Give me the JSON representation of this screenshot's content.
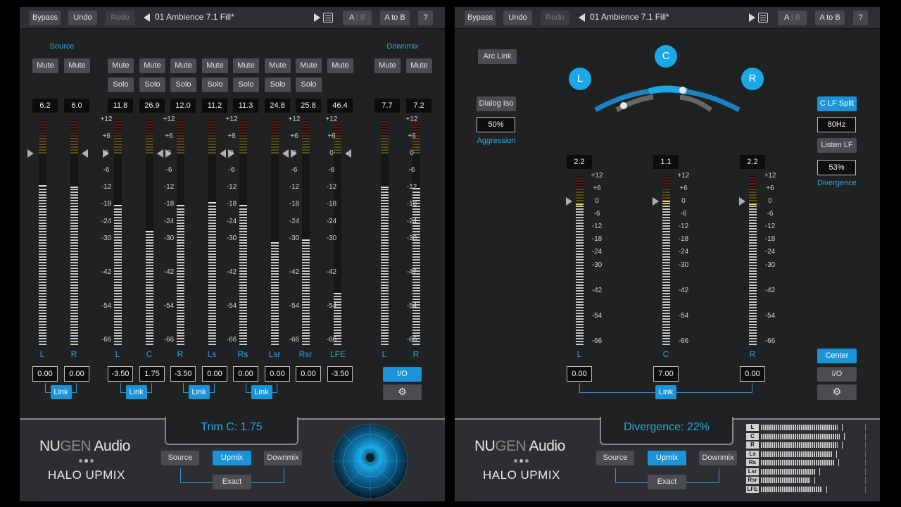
{
  "left": {
    "topbar": {
      "bypass": "Bypass",
      "undo": "Undo",
      "redo": "Redo",
      "preset": "01 Ambience 7.1 Fill*",
      "ab_a": "A",
      "ab_sep": "|",
      "ab_b": "B",
      "a_to_b": "A to B",
      "help": "?"
    },
    "sections": {
      "source": "Source",
      "downmix": "Downmix"
    },
    "mute": "Mute",
    "solo": "Solo",
    "readouts": [
      "6.2",
      "6.0",
      "11.8",
      "26.9",
      "12.0",
      "11.2",
      "11.3",
      "24.8",
      "25.8",
      "46.4",
      "7.7",
      "7.2"
    ],
    "scale": [
      "+12",
      "+6",
      "0",
      "-6",
      "-12",
      "-18",
      "-24",
      "-30",
      "-42",
      "-54",
      "-66"
    ],
    "channel_labels": [
      "L",
      "R",
      "L",
      "C",
      "R",
      "Ls",
      "Rs",
      "Lsr",
      "Rsr",
      "LFE",
      "L",
      "R"
    ],
    "gains": [
      "0.00",
      "0.00",
      "-3.50",
      "1.75",
      "-3.50",
      "0.00",
      "0.00",
      "0.00",
      "0.00",
      "-3.50"
    ],
    "link": "Link",
    "io": "I/O",
    "bottom_title": "Trim C: 1.75",
    "logo_nu": "NU",
    "logo_gen": "GEN",
    "logo_audio": " Audio",
    "product": "HALO  UPMIX",
    "modes": {
      "source": "Source",
      "upmix": "Upmix",
      "downmix": "Downmix",
      "exact": "Exact"
    }
  },
  "right": {
    "topbar": {
      "bypass": "Bypass",
      "undo": "Undo",
      "redo": "Redo",
      "preset": "01 Ambience 7.1 Fill*",
      "ab_a": "A",
      "ab_sep": "|",
      "ab_b": "B",
      "a_to_b": "A to B",
      "help": "?"
    },
    "arc_link": "Arc Link",
    "dialog_iso": "Dialog Iso",
    "aggression_value": "50%",
    "aggression_label": "Aggression",
    "speakers": {
      "l": "L",
      "c": "C",
      "r": "R"
    },
    "c_lf_split": "C LF Split",
    "freq": "80Hz",
    "listen_lf": "Listen LF",
    "divergence_value": "53%",
    "divergence_label": "Divergence",
    "readouts": [
      "2.2",
      "1.1",
      "2.2"
    ],
    "scale": [
      "+12",
      "+6",
      "0",
      "-6",
      "-12",
      "-18",
      "-24",
      "-30",
      "-42",
      "-54",
      "-66"
    ],
    "channel_labels": [
      "L",
      "C",
      "R"
    ],
    "gains": [
      "0.00",
      "7.00",
      "0.00"
    ],
    "link": "Link",
    "center": "Center",
    "io": "I/O",
    "bottom_title": "Divergence: 22%",
    "logo_nu": "NU",
    "logo_gen": "GEN",
    "logo_audio": " Audio",
    "product": "HALO  UPMIX",
    "modes": {
      "source": "Source",
      "upmix": "Upmix",
      "downmix": "Downmix",
      "exact": "Exact"
    },
    "mini_meter_labels": [
      "L",
      "C",
      "R",
      "Ls",
      "Rs",
      "Lsr",
      "Rsr",
      "LFE"
    ],
    "mini_meter_levels": [
      0.78,
      0.8,
      0.78,
      0.72,
      0.74,
      0.55,
      0.5,
      0.62
    ]
  },
  "colors": {
    "accent": "#1a94d6",
    "label_blue": "#2aa7e0",
    "panel": "#1f2123"
  }
}
